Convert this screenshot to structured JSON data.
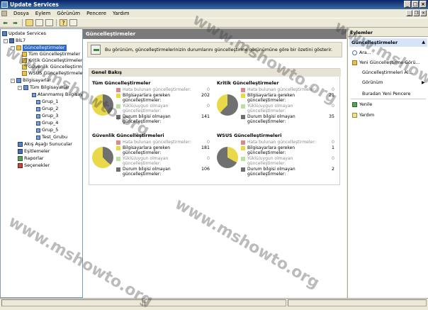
{
  "window": {
    "title": "Update Services"
  },
  "menu": [
    "Dosya",
    "Eylem",
    "Görünüm",
    "Pencere",
    "Yardım"
  ],
  "tree": {
    "root": "Update Services",
    "server": "BİL7",
    "updates": "Güncelleştirmeler",
    "updates_children": [
      "Tüm Güncelleştirmeler",
      "Kritik Güncelleştirmeler",
      "Güvenlik Güncelleştirme",
      "WSUS Güncelleştirmeleri"
    ],
    "computers": "Bilgisayarlar",
    "all_computers": "Tüm Bilgisayarlar",
    "computer_groups": [
      "Atanmamış Bilgisay",
      "Grup_1",
      "Grup_2",
      "Grup_3",
      "Grup_4",
      "Grup_5",
      "Test_Grubu"
    ],
    "others": [
      "Akış Aşağı Sunucular",
      "Eşitlemeler",
      "Raporlar",
      "Seçenekler"
    ]
  },
  "center": {
    "panel_title": "Güncelleştirmeler",
    "info_text": "Bu görünüm, güncelleştirmelerinizin durumlarını güncelleştirme görünümüne göre bir özetini gösterir.",
    "overview_title": "Genel Bakış",
    "quadrants": [
      {
        "title": "Tüm Güncelleştirmeler",
        "rows": [
          {
            "label": "Hata bulunan güncelleştirmeler:",
            "value": "0",
            "dim": true,
            "color": "#d88a8a"
          },
          {
            "label": "Bilgisayarlara gereken güncelleştirmeler:",
            "value": "202",
            "dim": false,
            "color": "#e8d84a"
          },
          {
            "label": "Yüklü/uygun olmayan güncelleştirmeler:",
            "value": "0",
            "dim": true,
            "color": "#b8e0a0"
          },
          {
            "label": "Durum bilgisi olmayan güncelleştirmeler:",
            "value": "141",
            "dim": false,
            "color": "#707070"
          }
        ]
      },
      {
        "title": "Kritik Güncelleştirmeler",
        "rows": [
          {
            "label": "Hata bulunan güncelleştirmeler:",
            "value": "0",
            "dim": true,
            "color": "#d88a8a"
          },
          {
            "label": "Bilgisayarlara gereken güncelleştirmeler:",
            "value": "21",
            "dim": false,
            "color": "#e8d84a"
          },
          {
            "label": "Yüklü/uygun olmayan güncelleştirmeler:",
            "value": "0",
            "dim": true,
            "color": "#b8e0a0"
          },
          {
            "label": "Durum bilgisi olmayan güncelleştirmeler:",
            "value": "35",
            "dim": false,
            "color": "#707070"
          }
        ]
      },
      {
        "title": "Güvenlik Güncelleştirmeleri",
        "rows": [
          {
            "label": "Hata bulunan güncelleştirmeler:",
            "value": "0",
            "dim": true,
            "color": "#d88a8a"
          },
          {
            "label": "Bilgisayarlara gereken güncelleştirmeler:",
            "value": "181",
            "dim": false,
            "color": "#e8d84a"
          },
          {
            "label": "Yüklü/uygun olmayan güncelleştirmeler:",
            "value": "0",
            "dim": true,
            "color": "#b8e0a0"
          },
          {
            "label": "Durum bilgisi olmayan güncelleştirmeler:",
            "value": "106",
            "dim": false,
            "color": "#707070"
          }
        ]
      },
      {
        "title": "WSUS Güncelleştirmeleri",
        "rows": [
          {
            "label": "Hata bulunan güncelleştirmeler:",
            "value": "0",
            "dim": true,
            "color": "#d88a8a"
          },
          {
            "label": "Bilgisayarlara gereken güncelleştirmeler:",
            "value": "1",
            "dim": false,
            "color": "#e8d84a"
          },
          {
            "label": "Yüklü/uygun olmayan güncelleştirmeler:",
            "value": "0",
            "dim": true,
            "color": "#b8e0a0"
          },
          {
            "label": "Durum bilgisi olmayan güncelleştirmeler:",
            "value": "2",
            "dim": false,
            "color": "#707070"
          }
        ]
      }
    ]
  },
  "actions": {
    "header": "Eylemler",
    "section": "Güncelleştirmeler",
    "items": [
      "Ara...",
      "Yeni Güncelleştirme Görü...",
      "Güncelleştirmeleri Al...",
      "Görünüm",
      "Buradan Yeni Pencere",
      "Yenile",
      "Yardım"
    ]
  },
  "watermark": "www.mshowto.org",
  "colors": {
    "selected": "#316ac5",
    "panel_header": "#7a7a7a",
    "action_section": "#d6e4f7"
  }
}
